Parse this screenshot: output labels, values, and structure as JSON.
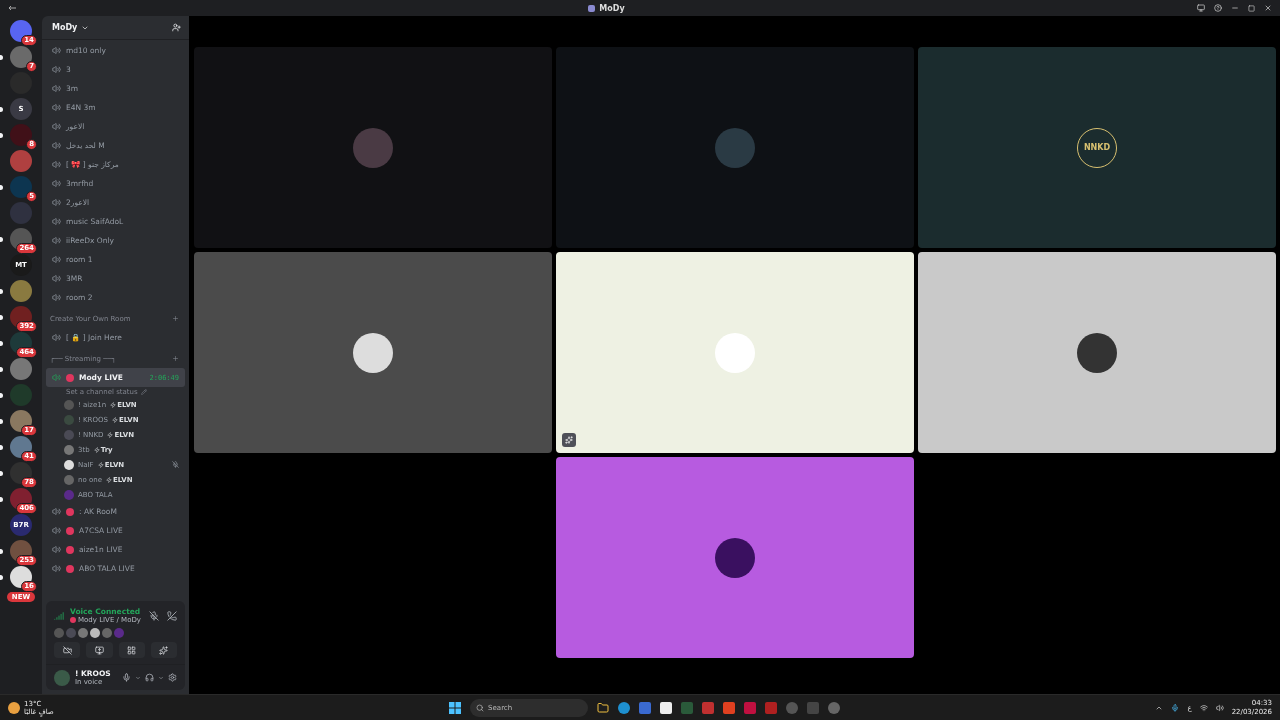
{
  "window": {
    "title": "MoDy"
  },
  "servers": [
    {
      "badge": "14",
      "unread": false
    },
    {
      "badge": "7",
      "unread": true
    },
    {
      "unread": false
    },
    {
      "label": "S",
      "unread": true
    },
    {
      "badge": "8",
      "unread": true
    },
    {
      "unread": false
    },
    {
      "badge": "5",
      "unread": true
    },
    {
      "unread": false
    },
    {
      "badge": "264",
      "unread": true
    },
    {
      "label": "MT",
      "unread": false
    },
    {
      "unread": true
    },
    {
      "badge": "392",
      "unread": true
    },
    {
      "badge": "464",
      "unread": true
    },
    {
      "unread": true
    },
    {
      "unread": true
    },
    {
      "badge": "17",
      "unread": true
    },
    {
      "badge": "41",
      "unread": true
    },
    {
      "badge": "78",
      "unread": true
    },
    {
      "badge": "406",
      "unread": true
    },
    {
      "label": "B7R",
      "unread": false
    },
    {
      "badge": "253",
      "unread": true
    },
    {
      "badge": "16",
      "unread": true
    }
  ],
  "new_badge": "NEW",
  "server_name": "MoDy",
  "channels": [
    {
      "kind": "voice",
      "name": "md10 only"
    },
    {
      "kind": "voice",
      "name": "3"
    },
    {
      "kind": "voice",
      "name": "3m"
    },
    {
      "kind": "voice",
      "name": "E4N 3m"
    },
    {
      "kind": "voice",
      "name": "الاعور"
    },
    {
      "kind": "voice",
      "name": "لحد يدخل M"
    },
    {
      "kind": "voice",
      "name": "[ 🎀 ] مركاز جنو"
    },
    {
      "kind": "voice",
      "name": "3mrfhd"
    },
    {
      "kind": "voice",
      "name": "الاعور2"
    },
    {
      "kind": "voice",
      "name": "music SaifAdoL"
    },
    {
      "kind": "voice",
      "name": "iiReeDx Only"
    },
    {
      "kind": "voice",
      "name": "room 1"
    },
    {
      "kind": "voice",
      "name": "3MR"
    },
    {
      "kind": "voice",
      "name": "room 2"
    },
    {
      "kind": "category",
      "name": "Create Your Own Room"
    },
    {
      "kind": "voice",
      "name": "[ 🔒 ]  Join Here"
    },
    {
      "kind": "category",
      "name": "┌── Streaming ──┐"
    },
    {
      "kind": "live",
      "name": "Mody LIVE",
      "selected": true,
      "timer": "2:06:49",
      "status": "Set a channel status",
      "members": [
        {
          "name": "! aize1n",
          "tag": "ELVN",
          "muted": false
        },
        {
          "name": "! KROOS",
          "tag": "ELVN",
          "muted": false
        },
        {
          "name": "! NNKD",
          "tag": "ELVN",
          "muted": false
        },
        {
          "name": "3tb",
          "tag": "Try",
          "muted": false
        },
        {
          "name": "NaIF",
          "tag": "ELVN",
          "muted": true
        },
        {
          "name": "no one",
          "tag": "ELVN",
          "muted": false
        },
        {
          "name": "ABO TALA",
          "muted": false
        }
      ]
    },
    {
      "kind": "live",
      "name": ": AK RooM",
      "selected": false
    },
    {
      "kind": "live",
      "name": "A7CSA LIVE",
      "selected": false
    },
    {
      "kind": "live",
      "name": "aize1n LIVE",
      "selected": false
    },
    {
      "kind": "live",
      "name": "ABO TALA LIVE",
      "selected": false
    }
  ],
  "voice_panel": {
    "title": "Voice Connected",
    "location": "Mody LIVE / MoDy"
  },
  "user": {
    "name": "! KROOS",
    "status": "In voice"
  },
  "tiles": [
    {
      "kind": "tile",
      "color": "#111114",
      "pinned": false
    },
    {
      "kind": "tile",
      "color": "#0e1115",
      "pinned": false
    },
    {
      "kind": "tile",
      "color": "#1b2c2e",
      "avatar_text": "NNKD",
      "pinned": false
    },
    {
      "kind": "tile",
      "color": "#4b4b4b",
      "pinned": false
    },
    {
      "kind": "tile",
      "color": "#eef1e3",
      "pinned": true
    },
    {
      "kind": "tile",
      "color": "#c9c9c9",
      "pinned": false
    },
    {
      "kind": "empty"
    },
    {
      "kind": "tile",
      "color": "#b75be0",
      "pinned": false
    },
    {
      "kind": "empty"
    }
  ],
  "taskbar": {
    "temperature": "13°C",
    "weather": "صافٍ غالبًا",
    "search_placeholder": "Search",
    "language": "ع",
    "time": "04:33",
    "date": "22/03/2026"
  }
}
